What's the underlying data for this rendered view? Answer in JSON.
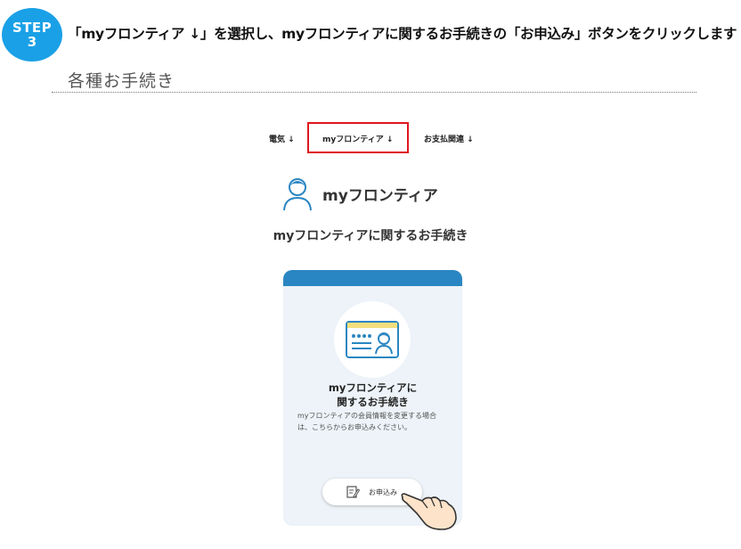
{
  "step": {
    "word": "STEP",
    "number": "3"
  },
  "instruction": "「myフロンティア ↓」を選択し、myフロンティアに関するお手続きの「お申込み」ボタンをクリックします",
  "section_title": "各種お手続き",
  "tabs": [
    {
      "label": "電気 ↓"
    },
    {
      "label": "myフロンティア ↓",
      "highlighted": true
    },
    {
      "label": "お支払関連 ↓"
    }
  ],
  "heading": "myフロンティア",
  "subheading": "myフロンティアに関するお手続き",
  "card": {
    "title_line1": "myフロンティアに",
    "title_line2": "関するお手続き",
    "description": "myフロンティアの会員情報を変更する場合は、こちらからお申込みください。",
    "button_label": "お申込み"
  },
  "colors": {
    "badge": "#1aa0e6",
    "highlight": "#e0161d",
    "card_header": "#2a86c2",
    "card_bg": "#edf3f8"
  }
}
